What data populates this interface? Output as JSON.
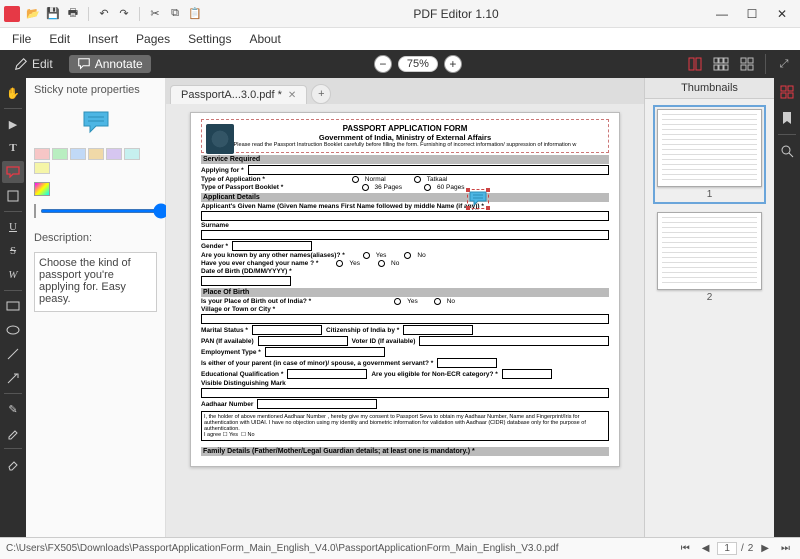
{
  "app": {
    "title": "PDF Editor 1.10"
  },
  "menu": [
    "File",
    "Edit",
    "Insert",
    "Pages",
    "Settings",
    "About"
  ],
  "modebar": {
    "edit": "Edit",
    "annotate": "Annotate",
    "zoom": "75%"
  },
  "tab": {
    "name": "PassportA...3.0.pdf *"
  },
  "properties": {
    "title": "Sticky note properties",
    "opacity": "100%",
    "desc_label": "Description:",
    "description": "Choose the kind of passport you're applying for. Easy peasy.",
    "swatches": [
      "#f7c6c6",
      "#b9eec1",
      "#c1d9f7",
      "#f0d9a8",
      "#d6c6f0",
      "#c6f0ef",
      "#f5f5a8"
    ]
  },
  "thumbnails": {
    "title": "Thumbnails",
    "pages": [
      "1",
      "2"
    ]
  },
  "status": {
    "path": "C:\\Users\\FX505\\Downloads\\PassportApplicationForm_Main_English_V4.0\\PassportApplicationForm_Main_English_V3.0.pdf",
    "page_current": "1",
    "page_sep": "/",
    "page_total": "2"
  },
  "form": {
    "title1": "PASSPORT APPLICATION FORM",
    "title2": "Government of India, Ministry of External Affairs",
    "note": "Please read the Passport Instruction Booklet carefully before filling the form. Furnishing of incorrect information/ suppression of information w",
    "sec_service": "Service Required",
    "applying_for": "Applying for *",
    "type_app": "Type of Application *",
    "type_app_opts": [
      "Normal",
      "Tatkaal"
    ],
    "type_booklet": "Type of Passport Booklet *",
    "type_booklet_opts": [
      "36 Pages",
      "60 Pages"
    ],
    "sec_applicant": "Applicant Details",
    "given_name": "Applicant's Given Name (Given Name means First Name followed by middle Name (if any)) *",
    "surname": "Surname",
    "gender": "Gender *",
    "aliases": "Are you known by any other names(aliases)? *",
    "changed_name": "Have you ever changed your name ? *",
    "yes": "Yes",
    "no": "No",
    "dob": "Date of Birth (DD/MM/YYYY) *",
    "sec_pob": "Place Of Birth",
    "pob_out": "Is your Place of Birth out of India? *",
    "village": "Village or Town or City *",
    "marital": "Marital Status *",
    "citizenship": "Citizenship of India by *",
    "pan": "PAN (If available)",
    "voter": "Voter ID (If available)",
    "employment": "Employment Type *",
    "parent_gov": "Is either of your parent (in case of minor)/ spouse, a government servant? *",
    "edu": "Educational Qualification *",
    "nonecr": "Are you eligible for Non-ECR category? *",
    "dist_mark": "Visible Distinguishing Mark",
    "aadhaar": "Aadhaar Number",
    "disclaimer": "I, the holder of above mentioned Aadhaar Number , hereby give my consent to Passport Seva to obtain my Aadhaar Number, Name and Fingerprint/Iris for authentication with UIDAI. I have no objection using my identity and biometric information for validation with Aadhaar (CIDR) database only for the purpose of authentication.",
    "agree": "I agree",
    "sec_family": "Family Details (Father/Mother/Legal Guardian details; at least one is mandatory.) *"
  }
}
